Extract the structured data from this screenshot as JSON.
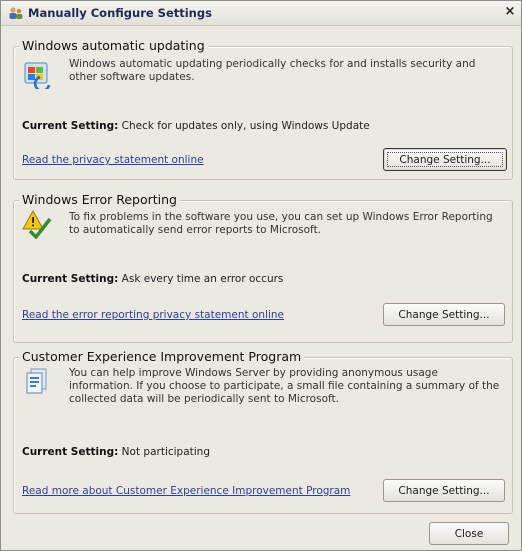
{
  "window": {
    "title": "Manually Configure Settings",
    "close_glyph": "×"
  },
  "sections": [
    {
      "title": "Windows automatic updating",
      "icon": "windows-update-icon",
      "description": "Windows automatic updating periodically checks for and installs security and other software updates.",
      "current_label": "Current Setting:",
      "current_value": "Check for updates only, using Windows Update",
      "link": "Read the privacy statement online",
      "button": "Change Setting..."
    },
    {
      "title": "Windows Error Reporting",
      "icon": "error-reporting-icon",
      "description": "To fix problems in the software you use, you can set up Windows Error Reporting to automatically send error reports to Microsoft.",
      "current_label": "Current Setting:",
      "current_value": "Ask every time an error occurs",
      "link": "Read the error reporting privacy statement online",
      "button": "Change Setting..."
    },
    {
      "title": "Customer Experience Improvement Program",
      "icon": "ceip-document-icon",
      "description": "You can help improve Windows Server by providing anonymous usage information. If you choose to participate, a small file containing a summary of the collected data will be periodically sent to Microsoft.",
      "current_label": "Current Setting:",
      "current_value": "Not participating",
      "link": "Read more about Customer Experience Improvement Program",
      "button": "Change Setting..."
    }
  ],
  "footer": {
    "close_button": "Close"
  },
  "colors": {
    "dialog_bg": "#ece9e3",
    "link": "#2b3f9f",
    "title_text": "#1e2a55"
  }
}
